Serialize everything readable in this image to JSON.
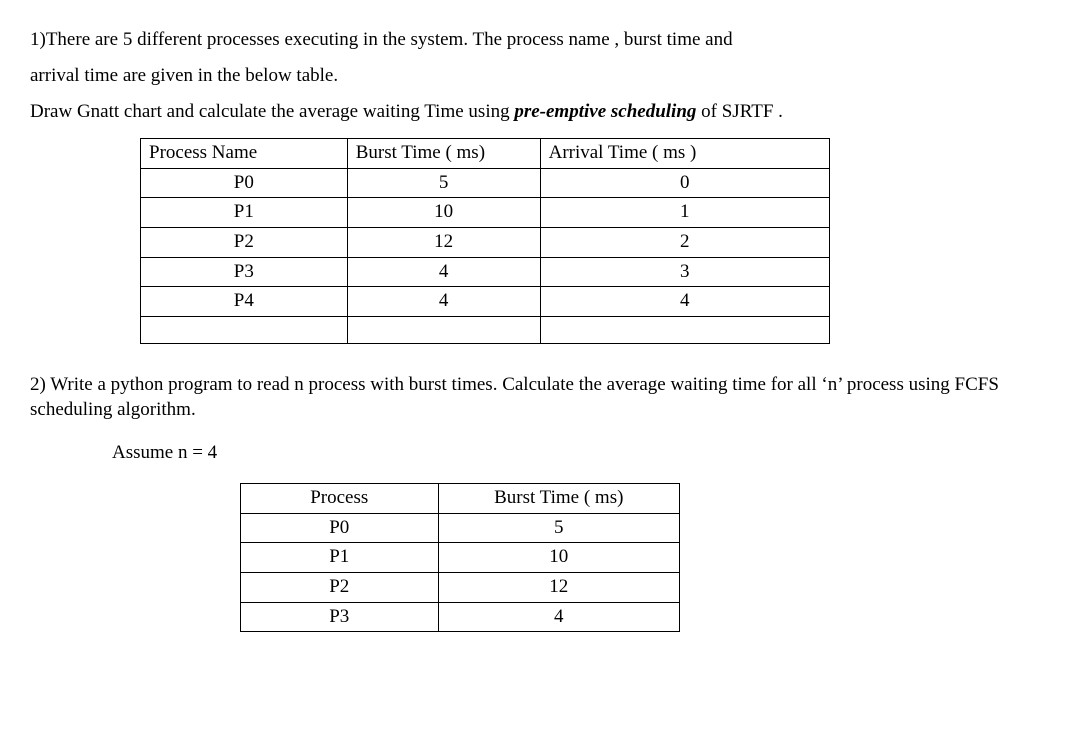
{
  "q1": {
    "line1": "1)There are 5 different processes executing in the system. The process name , burst time and",
    "line2": "arrival time are given in the below table.",
    "line3_pre": "Draw Gnatt chart and calculate the average waiting Time using ",
    "line3_em": "pre-emptive  scheduling",
    "line3_post": " of  SJRTF .",
    "table": {
      "headers": [
        "Process Name",
        "Burst Time ( ms)",
        "Arrival Time ( ms )"
      ],
      "rows": [
        [
          "P0",
          "5",
          "0"
        ],
        [
          "P1",
          "10",
          "1"
        ],
        [
          "P2",
          "12",
          "2"
        ],
        [
          "P3",
          "4",
          "3"
        ],
        [
          "P4",
          "4",
          "4"
        ]
      ]
    }
  },
  "q2": {
    "line1": "2) Write a python program to read n process with burst times. Calculate the average waiting time for all ‘n’ process using FCFS scheduling algorithm.",
    "assume": "Assume n = 4",
    "table": {
      "headers": [
        "Process",
        "Burst Time ( ms)"
      ],
      "rows": [
        [
          "P0",
          "5"
        ],
        [
          "P1",
          "10"
        ],
        [
          "P2",
          "12"
        ],
        [
          "P3",
          "4"
        ]
      ]
    }
  }
}
